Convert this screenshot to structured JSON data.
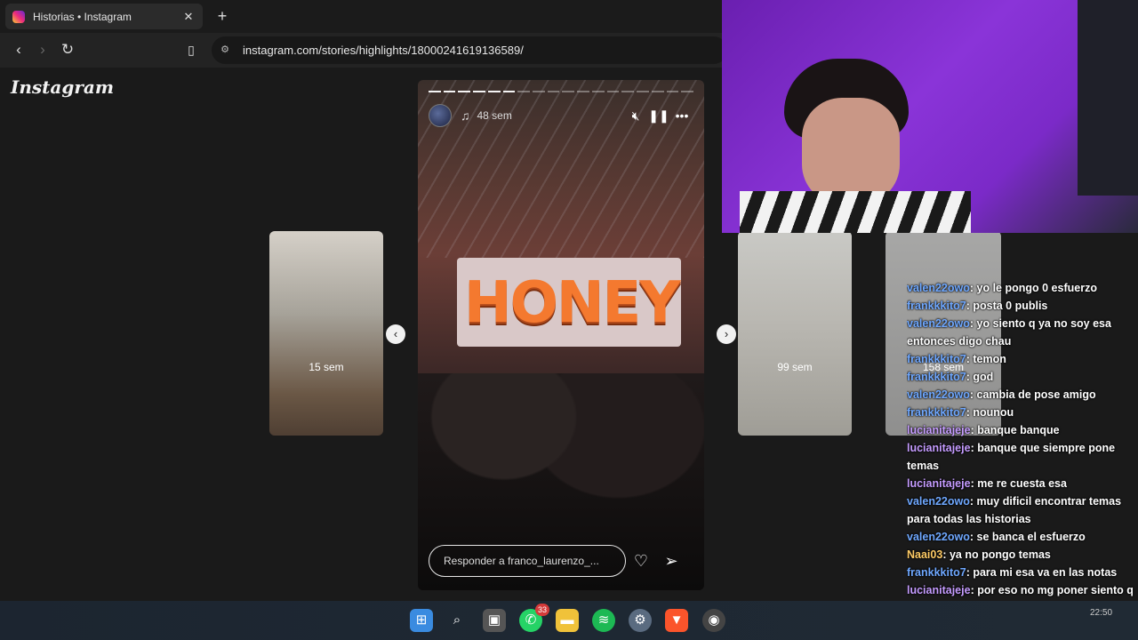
{
  "browser": {
    "tab_title": "Historias • Instagram",
    "tab_close": "✕",
    "new_tab": "+",
    "url": "instagram.com/stories/highlights/18000241619136589/"
  },
  "page": {
    "logo": "Instagram"
  },
  "story": {
    "time": "48 sem",
    "reply_placeholder": "Responder a franco_laurenzo_...",
    "banner_text": "HONEY",
    "progress_total": 18,
    "progress_done": 6
  },
  "thumbs": {
    "left_label": "15 sem",
    "right_label": "99 sem",
    "far_label": "158 sem"
  },
  "chat": {
    "messages": [
      {
        "user": "valen22owo",
        "color": "#6fa8ff",
        "text": "yo le pongo 0 esfuerzo"
      },
      {
        "user": "frankkkito7",
        "color": "#6fa8ff",
        "text": "posta 0 publis"
      },
      {
        "user": "valen22owo",
        "color": "#6fa8ff",
        "text": "yo siento q ya no soy esa entonces digo chau"
      },
      {
        "user": "frankkkito7",
        "color": "#6fa8ff",
        "text": "temon"
      },
      {
        "user": "frankkkito7",
        "color": "#6fa8ff",
        "text": "god"
      },
      {
        "user": "valen22owo",
        "color": "#6fa8ff",
        "text": "cambia de pose amigo"
      },
      {
        "user": "frankkkito7",
        "color": "#6fa8ff",
        "text": "nounou"
      },
      {
        "user": "lucianitajeje",
        "color": "#c59cff",
        "text": "banque banque"
      },
      {
        "user": "lucianitajeje",
        "color": "#c59cff",
        "text": "banque que siempre pone temas"
      },
      {
        "user": "lucianitajeje",
        "color": "#c59cff",
        "text": "me re cuesta esa"
      },
      {
        "user": "valen22owo",
        "color": "#6fa8ff",
        "text": "muy dificil encontrar temas para todas las historias"
      },
      {
        "user": "valen22owo",
        "color": "#6fa8ff",
        "text": "se banca el esfuerzo"
      },
      {
        "user": "Naai03",
        "color": "#ffcc66",
        "text": "ya no pongo temas"
      },
      {
        "user": "frankkkito7",
        "color": "#6fa8ff",
        "text": "para mi esa va en las notas"
      },
      {
        "user": "lucianitajeje",
        "color": "#c59cff",
        "text": "por eso no mg poner siento q van a decir se hace la culta"
      }
    ]
  },
  "taskbar": {
    "whatsapp_badge": "33",
    "clock": "22:50"
  }
}
